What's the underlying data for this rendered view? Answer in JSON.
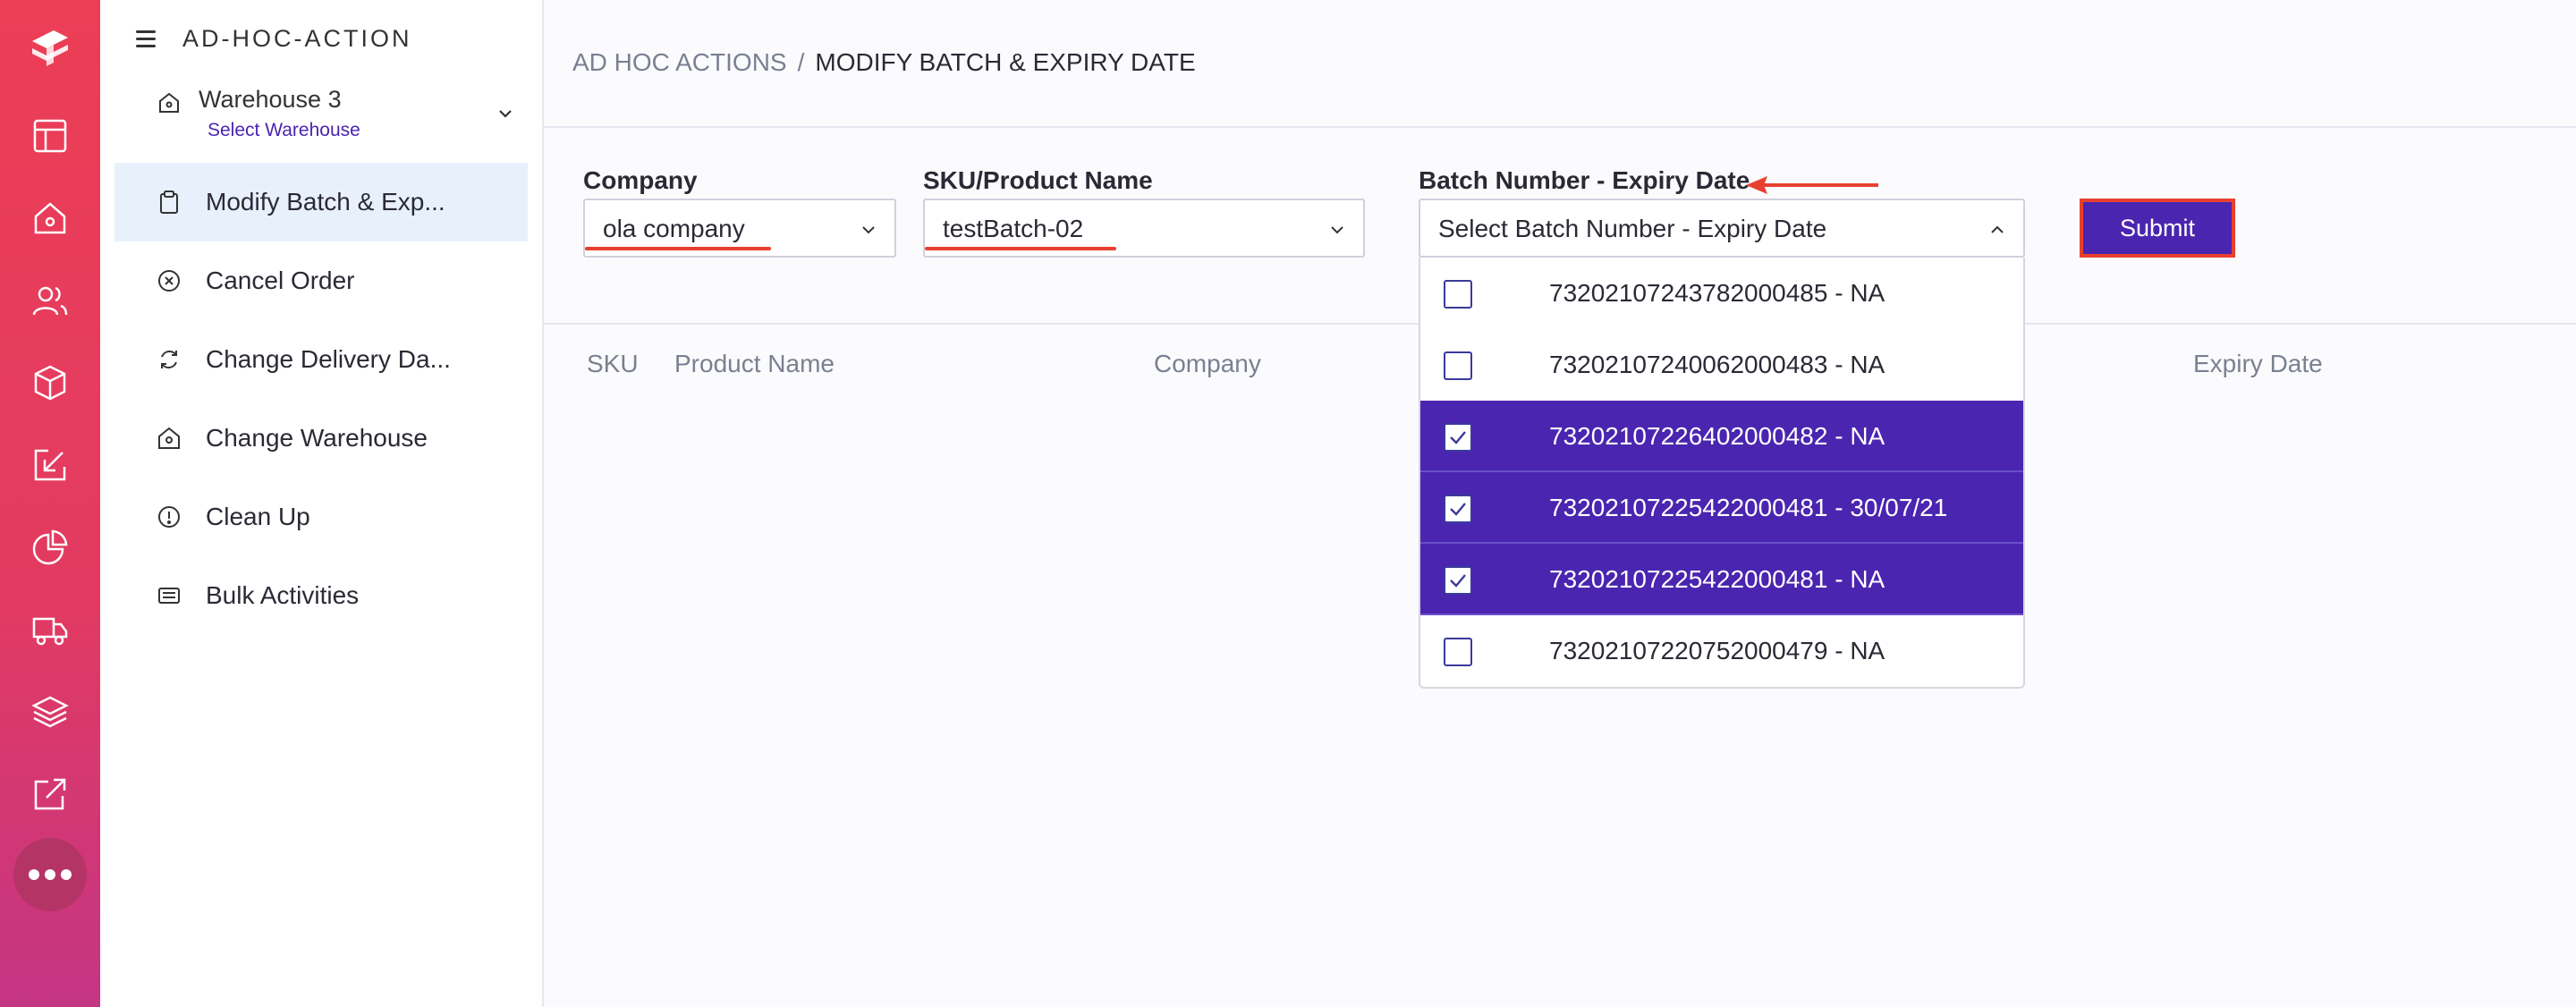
{
  "header": {
    "title": "AD-HOC-ACTION"
  },
  "warehouse": {
    "name": "Warehouse 3",
    "sub": "Select Warehouse"
  },
  "nav": {
    "items": [
      {
        "label": "Modify Batch & Exp...",
        "icon": "clipboard-icon",
        "active": true
      },
      {
        "label": "Cancel Order",
        "icon": "cancel-circle-icon"
      },
      {
        "label": "Change Delivery Da...",
        "icon": "refresh-icon"
      },
      {
        "label": "Change Warehouse",
        "icon": "home-icon"
      },
      {
        "label": "Clean Up",
        "icon": "alert-circle-icon"
      },
      {
        "label": "Bulk Activities",
        "icon": "list-icon"
      }
    ]
  },
  "breadcrumb": {
    "parent": "AD HOC ACTIONS",
    "separator": "/",
    "current": "MODIFY BATCH & EXPIRY DATE"
  },
  "form": {
    "company_label": "Company",
    "company_value": "ola company",
    "sku_label": "SKU/Product Name",
    "sku_value": "testBatch-02",
    "batch_label": "Batch Number - Expiry Date",
    "batch_placeholder": "Select Batch Number - Expiry Date",
    "submit_label": "Submit"
  },
  "batch_options": [
    {
      "label": "73202107243782000485 - NA",
      "checked": false
    },
    {
      "label": "73202107240062000483 - NA",
      "checked": false
    },
    {
      "label": "73202107226402000482 - NA",
      "checked": true
    },
    {
      "label": "73202107225422000481 - 30/07/21",
      "checked": true
    },
    {
      "label": "73202107225422000481 - NA",
      "checked": true
    },
    {
      "label": "73202107220752000479 - NA",
      "checked": false
    }
  ],
  "table": {
    "columns": [
      "SKU",
      "Product Name",
      "Company",
      "Expiry Date"
    ]
  },
  "colors": {
    "accent": "#4a25b0",
    "brand": "#ec3e55",
    "highlight": "#e8402f"
  }
}
